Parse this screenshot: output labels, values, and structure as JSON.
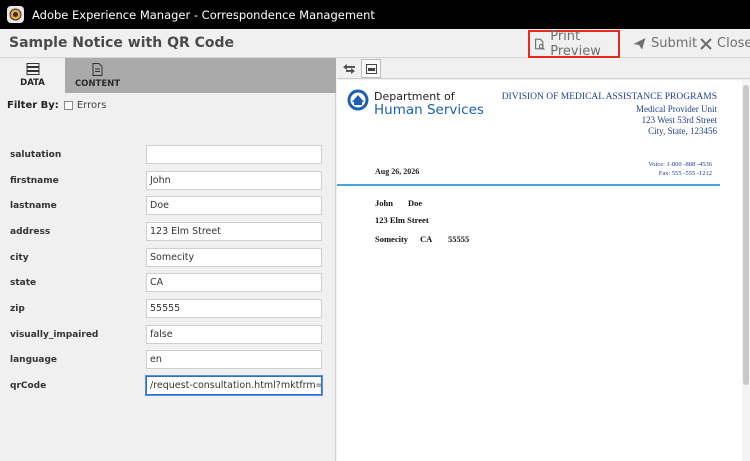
{
  "window": {
    "title": "Adobe Experience Manager - Correspondence Management"
  },
  "header": {
    "doc_title": "Sample Notice with QR Code",
    "print_preview_label": "Print Preview",
    "submit_label": "Submit",
    "close_label": "Close"
  },
  "left": {
    "tabs": [
      {
        "label": "DATA"
      },
      {
        "label": "CONTENT"
      }
    ],
    "filter_label": "Filter By:",
    "filter_errors_label": "Errors",
    "fields": [
      {
        "label": "salutation",
        "value": ""
      },
      {
        "label": "firstname",
        "value": "John"
      },
      {
        "label": "lastname",
        "value": "Doe"
      },
      {
        "label": "address",
        "value": "123 Elm Street"
      },
      {
        "label": "city",
        "value": "Somecity"
      },
      {
        "label": "state",
        "value": "CA"
      },
      {
        "label": "zip",
        "value": "55555"
      },
      {
        "label": "visually_impaired",
        "value": "false"
      },
      {
        "label": "language",
        "value": "en"
      },
      {
        "label": "qrCode",
        "value": "/request-consultation.html?mktfrm=government"
      }
    ]
  },
  "preview": {
    "logo_line1": "Department of",
    "logo_line2": "Human Services",
    "division": "DIVISION OF MEDICAL ASSISTANCE PROGRAMS",
    "address_lines": [
      "Medical Provider Unit",
      "123 West 53rd Street",
      "City, State, 123456"
    ],
    "date": "Aug 26, 2026",
    "voice": "Voice:    1-800 -888 -4536",
    "fax": "Fax:  555 -555 -1212",
    "recipient": {
      "firstname": "John",
      "lastname": "Doe",
      "street": "123 Elm Street",
      "city": "Somecity",
      "state": "CA",
      "zip": "55555"
    }
  },
  "colors": {
    "accent_blue": "#1a5fb4",
    "highlight_red": "#e8291c",
    "rule_blue": "#4aa3e2"
  }
}
